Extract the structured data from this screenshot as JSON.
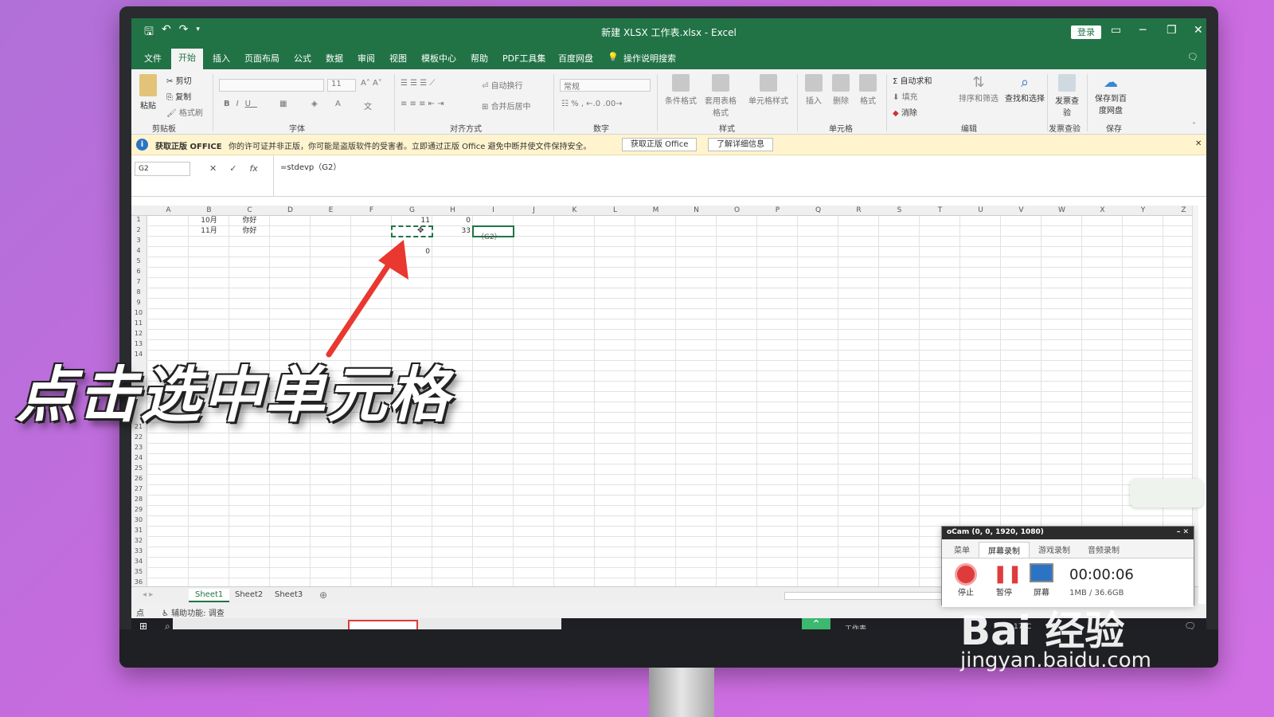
{
  "titlebar": {
    "title": "新建 XLSX 工作表.xlsx - Excel",
    "login": "登录"
  },
  "tabs": [
    "文件",
    "开始",
    "插入",
    "页面布局",
    "公式",
    "数据",
    "审阅",
    "视图",
    "模板中心",
    "帮助",
    "PDF工具集",
    "百度网盘"
  ],
  "tell_me": "操作说明搜索",
  "ribbon": {
    "clipboard": {
      "paste": "粘贴",
      "cut": "剪切",
      "copy": "复制",
      "painter": "格式刷",
      "label": "剪贴板"
    },
    "font": {
      "size": "11",
      "label": "字体"
    },
    "alignment": {
      "wrap": "自动换行",
      "merge": "合并后居中",
      "label": "对齐方式"
    },
    "number": {
      "format": "常规",
      "label": "数字"
    },
    "styles": {
      "cond": "条件格式",
      "table": "套用表格格式",
      "cell": "单元格样式",
      "label": "样式"
    },
    "cells": {
      "insert": "插入",
      "delete": "删除",
      "format": "格式",
      "label": "单元格"
    },
    "editing": {
      "autosum": "自动求和",
      "fill": "填充",
      "clear": "消除",
      "sort": "排序和筛选",
      "find": "查找和选择",
      "label": "编辑"
    },
    "invoice": {
      "btn": "发票查验",
      "label": "发票查验"
    },
    "save": {
      "btn": "保存到百度网盘",
      "label": "保存"
    }
  },
  "msgbar": {
    "title": "获取正版 OFFICE",
    "text": "你的许可证并非正版，你可能是盗版软件的受害者。立即通过正版 Office 避免中断并使文件保持安全。",
    "btn1": "获取正版 Office",
    "btn2": "了解详细信息"
  },
  "formula_bar": {
    "namebox": "G2",
    "formula": "=stdevp（G2）"
  },
  "columns": [
    "A",
    "B",
    "C",
    "D",
    "E",
    "F",
    "G",
    "H",
    "I",
    "J",
    "K",
    "L",
    "M",
    "N",
    "O",
    "P",
    "Q",
    "R",
    "S",
    "T",
    "U",
    "V",
    "W",
    "X",
    "Y",
    "Z"
  ],
  "rows": [
    "1",
    "2",
    "3",
    "4",
    "5",
    "6",
    "7",
    "8",
    "9",
    "10",
    "11",
    "12",
    "13",
    "14",
    "",
    "",
    "",
    "",
    "",
    "",
    "21",
    "22",
    "23",
    "24",
    "25",
    "26",
    "27",
    "28",
    "29",
    "30",
    "31",
    "32",
    "33",
    "34",
    "35",
    "36"
  ],
  "cells": {
    "b1": "10月",
    "c1": "你好",
    "g1": "11",
    "h1": "0",
    "b2": "11月",
    "c2": "你好",
    "h2": "33",
    "i2": "（G2）",
    "g4": "0"
  },
  "sheets": [
    "Sheet1",
    "Sheet2",
    "Sheet3"
  ],
  "status": {
    "mode": "点",
    "accessibility": "辅助功能: 调查"
  },
  "taskbar": {
    "weather": "17°C",
    "app": "工作表..."
  },
  "overlay_caption": "点击选中单元格",
  "ocam": {
    "title": "oCam (0, 0, 1920, 1080)",
    "tabs": [
      "菜单",
      "屏幕录制",
      "游戏录制",
      "音频录制"
    ],
    "stop": "停止",
    "pause": "暂停",
    "screen": "屏幕",
    "timer": "00:00:06",
    "storage": "1MB / 36.6GB"
  },
  "watermark": {
    "logo": "Bai 经验",
    "url": "jingyan.baidu.com"
  }
}
